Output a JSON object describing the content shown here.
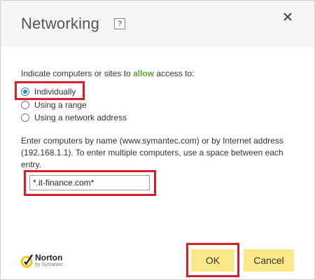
{
  "dialog": {
    "title": "Networking",
    "help_label": "?",
    "close_label": "✕"
  },
  "prompt": {
    "before": "Indicate computers or sites to ",
    "allow": "allow",
    "after": " access to:"
  },
  "options": [
    {
      "label": "Individually",
      "checked": true
    },
    {
      "label": "Using a range",
      "checked": false
    },
    {
      "label": "Using a network address",
      "checked": false
    }
  ],
  "description": "Enter computers by name (www.symantec.com) or by Internet address (192.168.1.1). To enter multiple computers, use a space between each entry.",
  "input": {
    "value": "*.it-finance.com*"
  },
  "logo": {
    "name": "Norton",
    "sub": "by Symantec"
  },
  "buttons": {
    "ok": "OK",
    "cancel": "Cancel"
  },
  "colors": {
    "highlight": "#d81e2a",
    "button": "#fde98a",
    "allow": "#5ba52f",
    "logo_yellow": "#f7c400"
  }
}
